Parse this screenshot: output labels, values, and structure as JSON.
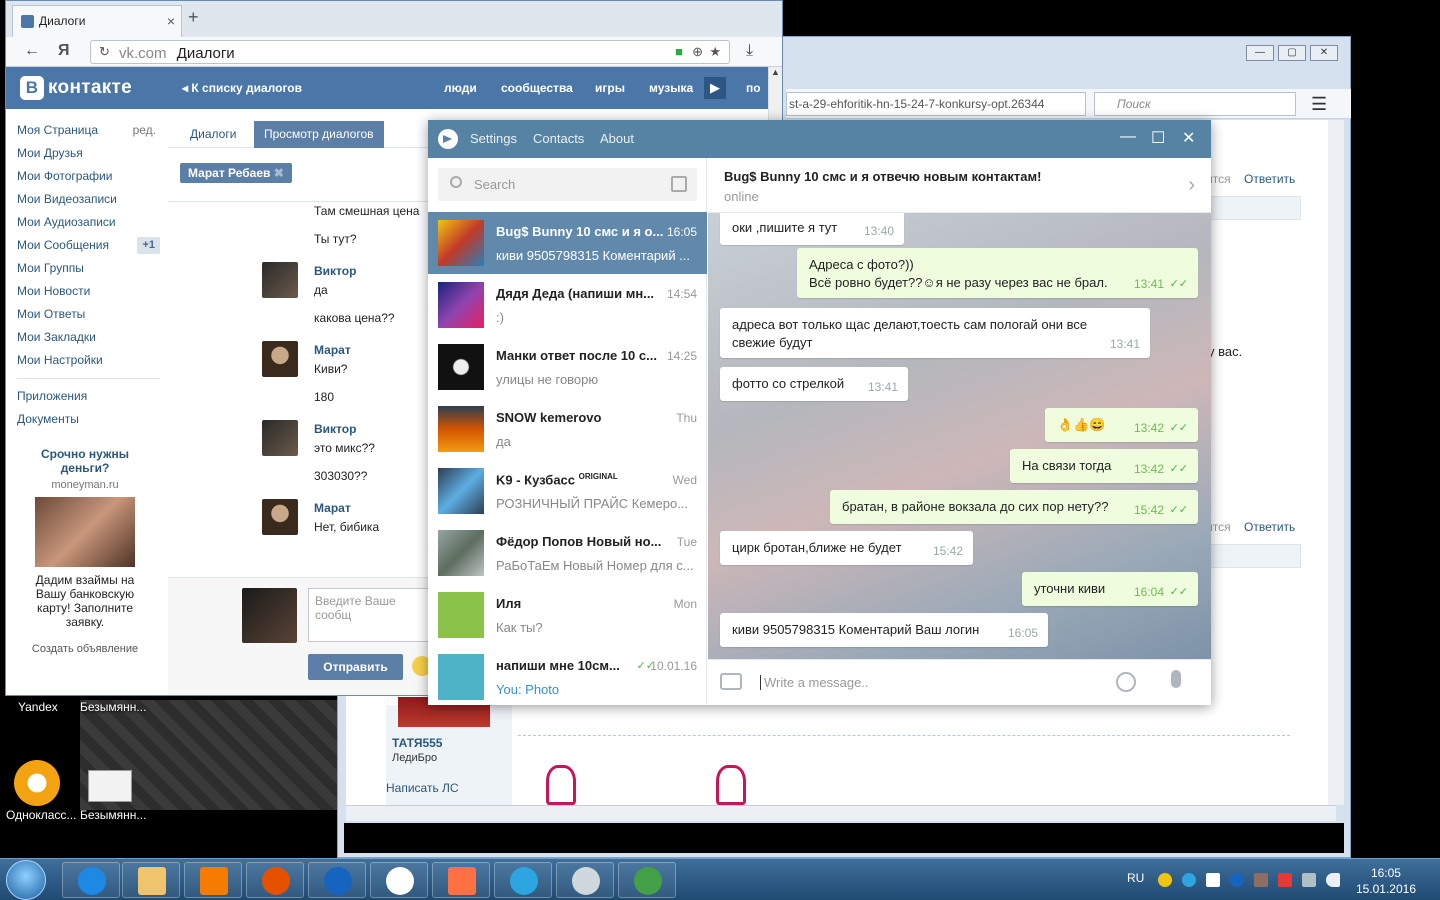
{
  "desktop": {
    "labels": [
      "Yandex",
      "Безымянн...",
      "Однокласс...",
      "Безымянн..."
    ]
  },
  "bg_browser": {
    "url": "st-a-29-ehforitik-hn-15-24-7-konkursy-opt.26344",
    "search_placeholder": "Поиск",
    "reply1": "Ответить",
    "partial1": "ится",
    "partial_text": "у вас.",
    "reply2": "Ответить",
    "partial2": "ится",
    "user_name": "ТАТЯ555",
    "user_sub": "ЛедиБро",
    "write_pm": "Написать ЛС"
  },
  "vk": {
    "tab_title": "Диалоги",
    "url_domain": "vk.com",
    "url_title": "Диалоги",
    "logo": "контакте",
    "back": "К списку диалогов",
    "menu": [
      "люди",
      "сообщества",
      "игры",
      "музыка",
      "по"
    ],
    "sidebar": [
      {
        "label": "Моя Страница",
        "extra": "ред."
      },
      {
        "label": "Мои Друзья"
      },
      {
        "label": "Мои Фотографии"
      },
      {
        "label": "Мои Видеозаписи"
      },
      {
        "label": "Мои Аудиозаписи"
      },
      {
        "label": "Мои Сообщения",
        "count": "+1"
      },
      {
        "label": "Мои Группы"
      },
      {
        "label": "Мои Новости"
      },
      {
        "label": "Мои Ответы"
      },
      {
        "label": "Мои Закладки"
      },
      {
        "label": "Мои Настройки"
      }
    ],
    "sidebar2": [
      "Приложения",
      "Документы"
    ],
    "ad": {
      "title": "Срочно нужны деньги?",
      "site": "moneyman.ru",
      "desc": "Дадим взаймы на Вашу банковскую карту! Заполните заявку.",
      "create": "Создать объявление"
    },
    "tabs": [
      "Диалоги",
      "Просмотр диалогов"
    ],
    "chip": "Марат Ребаев",
    "messages": [
      {
        "text": "Там смешная цена"
      },
      {
        "text": "Ты тут?"
      },
      {
        "name": "Виктор",
        "text": "да"
      },
      {
        "text": "какова цена??"
      },
      {
        "name": "Марат",
        "text": "Киви?"
      },
      {
        "text": "180"
      },
      {
        "name": "Виктор",
        "text": "это микс??"
      },
      {
        "text": "303030??"
      },
      {
        "name": "Марат",
        "text": "Нет, бибика"
      }
    ],
    "input_placeholder": "Введите Ваше сообщ",
    "send": "Отправить"
  },
  "tg": {
    "menu": [
      "Settings",
      "Contacts",
      "About"
    ],
    "search_placeholder": "Search",
    "chats": [
      {
        "name": "Bug$ Bunny 10 смс и я о...",
        "time": "16:05",
        "preview": "киви 9505798315 Коментарий ...",
        "selected": true,
        "color": "#c0392b"
      },
      {
        "name": "Дядя Деда (напиши мн...",
        "time": "14:54",
        "preview": ":)",
        "color": "#8e44ad"
      },
      {
        "name": "Манки ответ после 10 с...",
        "time": "14:25",
        "preview": "улицы не говорю",
        "color": "#111111"
      },
      {
        "name": "SNOW kemerovo",
        "time": "Thu",
        "preview": "да",
        "color": "#d35400"
      },
      {
        "name": "K9 - Кузбасс",
        "badge": "ORIGINAL",
        "time": "Wed",
        "preview": "РОЗНИЧНЫЙ ПРАЙС Кемеро...",
        "color": "#2c3e50"
      },
      {
        "name": "Фёдор Попов Новый но...",
        "time": "Tue",
        "preview": "РаБоТаЕм Новый Номер для с...",
        "color": "#7f8c8d"
      },
      {
        "name": "Иля",
        "time": "Mon",
        "preview": "Как ты?",
        "color": "#8bc34a"
      },
      {
        "name": "напиши мне 10см...",
        "time": "10.01.16",
        "preview": "You: Photo",
        "you": true,
        "color": "#4fb3c8"
      }
    ],
    "header_name": "Bug$ Bunny 10 смс и я отвечю новым контактам!",
    "header_status": "online",
    "messages": [
      {
        "dir": "in",
        "text": "оки ,пишите я тут",
        "time": "13:40"
      },
      {
        "dir": "out",
        "text": "Адреса с фото?))",
        "text2": "Всё ровно будет??☺я не разу через вас не брал.",
        "time": "13:41"
      },
      {
        "dir": "in",
        "text": "адреса вот только щас делают,тоесть сам пологай они все",
        "text2": "свежие будут",
        "time": "13:41"
      },
      {
        "dir": "in",
        "text": "фотто со стрелкой",
        "time": "13:41"
      },
      {
        "dir": "out",
        "text": "👌👍😄",
        "time": "13:42"
      },
      {
        "dir": "out",
        "text": "На связи тогда",
        "time": "13:42"
      },
      {
        "dir": "out",
        "text": "братан, в районе вокзала до сих пор нету??",
        "time": "15:42"
      },
      {
        "dir": "in",
        "text": "цирк бротан,ближе не будет",
        "time": "15:42"
      },
      {
        "dir": "out",
        "text": "уточни киви",
        "time": "16:04"
      },
      {
        "dir": "in",
        "text": "киви 9505798315 Коментарий Ваш логин",
        "time": "16:05"
      }
    ],
    "compose_placeholder": "Write a message..",
    "check": "✓✓"
  },
  "taskbar": {
    "lang": "RU",
    "time": "16:05",
    "date": "15.01.2016"
  },
  "colors": {
    "vk_blue": "#4a76a8",
    "tg_header": "#5682a3",
    "tg_selected": "#6189ac",
    "tg_out_bubble": "#effdde"
  }
}
